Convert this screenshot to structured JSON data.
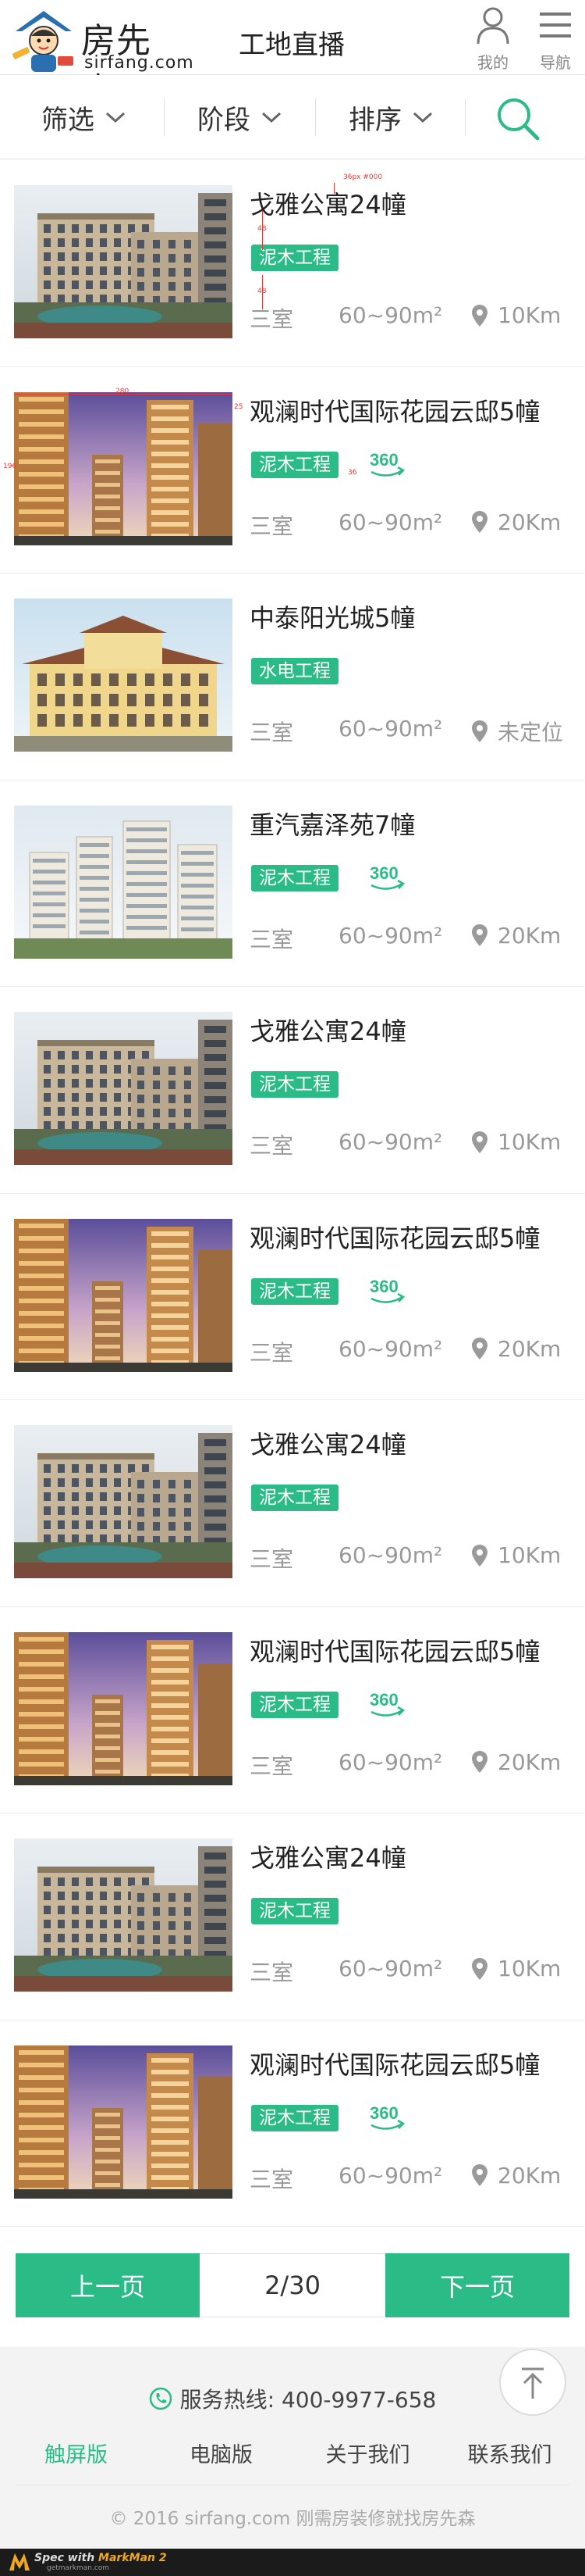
{
  "header": {
    "logo_cn": "房先森",
    "logo_en": "sirfang.com",
    "title": "工地直播",
    "my_label": "我的",
    "nav_label": "导航"
  },
  "filters": [
    {
      "label": "筛选",
      "icon": "chevron-down-icon"
    },
    {
      "label": "阶段",
      "icon": "chevron-down-icon"
    },
    {
      "label": "排序",
      "icon": "chevron-down-icon"
    }
  ],
  "search_icon": "search-icon",
  "accent_color": "#2bbb87",
  "items": [
    {
      "name": "戈雅公寓24幢",
      "tag": "泥木工程",
      "vr": false,
      "room": "三室",
      "area": "60~90m²",
      "location": "10Km",
      "image": "low-rise"
    },
    {
      "name": "观澜时代国际花园云邸5幢",
      "tag": "泥木工程",
      "vr": true,
      "vr_label": "360",
      "room": "三室",
      "area": "60~90m²",
      "location": "20Km",
      "image": "towers"
    },
    {
      "name": "中泰阳光城5幢",
      "tag": "水电工程",
      "vr": false,
      "room": "三室",
      "area": "60~90m²",
      "location": "未定位",
      "image": "villa"
    },
    {
      "name": "重汽嘉泽苑7幢",
      "tag": "泥木工程",
      "vr": true,
      "vr_label": "360",
      "room": "三室",
      "area": "60~90m²",
      "location": "20Km",
      "image": "white-towers"
    },
    {
      "name": "戈雅公寓24幢",
      "tag": "泥木工程",
      "vr": false,
      "room": "三室",
      "area": "60~90m²",
      "location": "10Km",
      "image": "low-rise"
    },
    {
      "name": "观澜时代国际花园云邸5幢",
      "tag": "泥木工程",
      "vr": true,
      "vr_label": "360",
      "room": "三室",
      "area": "60~90m²",
      "location": "20Km",
      "image": "towers"
    },
    {
      "name": "戈雅公寓24幢",
      "tag": "泥木工程",
      "vr": false,
      "room": "三室",
      "area": "60~90m²",
      "location": "10Km",
      "image": "low-rise"
    },
    {
      "name": "观澜时代国际花园云邸5幢",
      "tag": "泥木工程",
      "vr": true,
      "vr_label": "360",
      "room": "三室",
      "area": "60~90m²",
      "location": "20Km",
      "image": "towers"
    },
    {
      "name": "戈雅公寓24幢",
      "tag": "泥木工程",
      "vr": false,
      "room": "三室",
      "area": "60~90m²",
      "location": "10Km",
      "image": "low-rise"
    },
    {
      "name": "观澜时代国际花园云邸5幢",
      "tag": "泥木工程",
      "vr": true,
      "vr_label": "360",
      "room": "三室",
      "area": "60~90m²",
      "location": "20Km",
      "image": "towers"
    }
  ],
  "pagination": {
    "prev": "上一页",
    "page": "2/30",
    "next": "下一页"
  },
  "footer": {
    "hotline": "服务热线: 400-9977-658",
    "links": [
      "触屏版",
      "电脑版",
      "关于我们",
      "联系我们"
    ],
    "active_link": 0,
    "copyright": "© 2016 sirfang.com 刚需房装修就找房先森"
  },
  "markman": {
    "text_a": "Spec with ",
    "text_b": "MarkMan 2",
    "sub": "getmarkman.com"
  },
  "spec_notes": {
    "font": "36px #000",
    "gap1": "48",
    "gap2": "48",
    "img_w": "280",
    "img_h": "196",
    "edge": "25",
    "tag_gap": "36"
  }
}
